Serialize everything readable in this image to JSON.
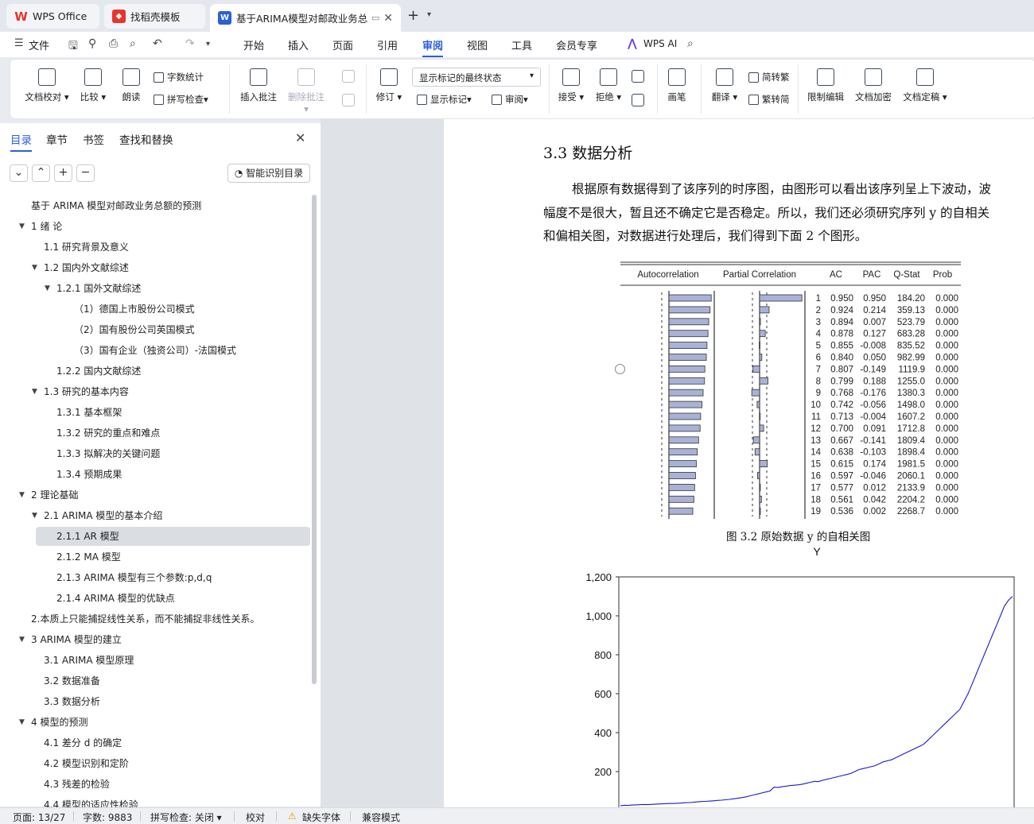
{
  "tabs": [
    {
      "label": "WPS Office",
      "icon": "wps-logo-icon",
      "color": "#e8342c"
    },
    {
      "label": "找稻壳模板",
      "icon": "docer-icon",
      "color": "#e8342c"
    },
    {
      "label": "基于ARIMA模型对邮政业务总",
      "icon": "word-doc-icon",
      "color": "#2b5fd9"
    }
  ],
  "menu": {
    "file": "文件",
    "items": [
      "开始",
      "插入",
      "页面",
      "引用",
      "审阅",
      "视图",
      "工具",
      "会员专享"
    ],
    "active": "审阅",
    "ai": "WPS AI"
  },
  "ribbon": {
    "doc_check": "文档校对",
    "compare": "比较",
    "read_aloud": "朗读",
    "word_count": "字数统计",
    "spell_check": "拼写检查",
    "insert_comment": "插入批注",
    "delete_comment": "删除批注",
    "revise": "修订",
    "mark_state": "显示标记的最终状态",
    "show_marks": "显示标记",
    "review": "审阅",
    "accept": "接受",
    "reject": "拒绝",
    "pen": "画笔",
    "translate": "翻译",
    "trad2simp": "简转繁",
    "simp2trad": "繁转简",
    "restrict": "限制编辑",
    "encrypt": "文档加密",
    "finalize": "文档定稿"
  },
  "sidebar": {
    "tabs": [
      "目录",
      "章节",
      "书签",
      "查找和替换"
    ],
    "smart_toc": "智能识别目录",
    "toc": [
      {
        "text": "基于 ARIMA 模型对邮政业务总额的预测",
        "level": 0
      },
      {
        "text": "1  绪  论",
        "level": 0,
        "arrow": true
      },
      {
        "text": "1.1  研究背景及意义",
        "level": 1
      },
      {
        "text": "1.2  国内外文献综述",
        "level": 1,
        "arrow": true
      },
      {
        "text": "1.2.1  国外文献综述",
        "level": 2,
        "arrow": true
      },
      {
        "text": "（1）德国上市股份公司模式",
        "level": 3
      },
      {
        "text": "（2）国有股份公司英国模式",
        "level": 3
      },
      {
        "text": "（3）国有企业（独资公司）-法国模式",
        "level": 3
      },
      {
        "text": "1.2.2  国内文献综述",
        "level": 2
      },
      {
        "text": "1.3  研究的基本内容",
        "level": 1,
        "arrow": true
      },
      {
        "text": "1.3.1  基本框架",
        "level": 2
      },
      {
        "text": "1.3.2  研究的重点和难点",
        "level": 2
      },
      {
        "text": "1.3.3  拟解决的关键问题",
        "level": 2
      },
      {
        "text": "1.3.4  预期成果",
        "level": 2
      },
      {
        "text": "2  理论基础",
        "level": 0,
        "arrow": true
      },
      {
        "text": "2.1    ARIMA 模型的基本介绍",
        "level": 1,
        "arrow": true
      },
      {
        "text": "2.1.1    AR 模型",
        "level": 2,
        "selected": true
      },
      {
        "text": "2.1.2    MA 模型",
        "level": 2
      },
      {
        "text": "2.1.3 ARIMA 模型有三个参数:p,d,q",
        "level": 2
      },
      {
        "text": "2.1.4    ARIMA 模型的优缺点",
        "level": 2
      },
      {
        "text": "2.本质上只能捕捉线性关系，而不能捕捉非线性关系。",
        "level": 0
      },
      {
        "text": "3 ARIMA 模型的建立",
        "level": 0,
        "arrow": true
      },
      {
        "text": "3.1 ARIMA 模型原理",
        "level": 1
      },
      {
        "text": "3.2  数据准备",
        "level": 1
      },
      {
        "text": "3.3  数据分析",
        "level": 1
      },
      {
        "text": "4  模型的预测",
        "level": 0,
        "arrow": true
      },
      {
        "text": "4.1  差分 d 的确定",
        "level": 1
      },
      {
        "text": "4.2  模型识别和定阶",
        "level": 1
      },
      {
        "text": "4.3 残差的检验",
        "level": 1
      },
      {
        "text": "4.4  模型的适应性检验",
        "level": 1
      }
    ]
  },
  "doc": {
    "heading": "3.3  数据分析",
    "para1": "根据原有数据得到了该序列的时序图，由图形可以看出该序列呈上下波动，波",
    "para2": "幅度不是很大，暂且还不确定它是否稳定。所以，我们还必须研究序列 y 的自相关",
    "para3": "和偏相关图，对数据进行处理后，我们得到下面 2 个图形。",
    "fig_caption": "图 3.2 原始数据 y 的自相关图"
  },
  "chart_data": [
    {
      "type": "table",
      "columns": [
        "Autocorrelation",
        "Partial Correlation",
        "",
        "AC",
        "PAC",
        "Q-Stat",
        "Prob"
      ],
      "lags": [
        1,
        2,
        3,
        4,
        5,
        6,
        7,
        8,
        9,
        10,
        11,
        12,
        13,
        14,
        15,
        16,
        17,
        18,
        19
      ],
      "ac": [
        0.95,
        0.924,
        0.894,
        0.878,
        0.855,
        0.84,
        0.807,
        0.799,
        0.768,
        0.742,
        0.713,
        0.7,
        0.667,
        0.638,
        0.615,
        0.597,
        0.577,
        0.561,
        0.536
      ],
      "pac": [
        0.95,
        0.214,
        0.007,
        0.127,
        -0.008,
        0.05,
        -0.149,
        0.188,
        -0.176,
        -0.056,
        -0.004,
        0.091,
        -0.141,
        -0.103,
        0.174,
        -0.046,
        0.012,
        0.042,
        0.002
      ],
      "qstat": [
        "184.20",
        "359.13",
        "523.79",
        "683.28",
        "835.52",
        "982.99",
        "1119.9",
        "1255.0",
        "1380.3",
        "1498.0",
        "1607.2",
        "1712.8",
        "1809.4",
        "1898.4",
        "1981.5",
        "2060.1",
        "2133.9",
        "2204.2",
        "2268.7"
      ],
      "prob": [
        "0.000",
        "0.000",
        "0.000",
        "0.000",
        "0.000",
        "0.000",
        "0.000",
        "0.000",
        "0.000",
        "0.000",
        "0.000",
        "0.000",
        "0.000",
        "0.000",
        "0.000",
        "0.000",
        "0.000",
        "0.000",
        "0.000"
      ],
      "ac_text": [
        "0.950",
        "0.924",
        "0.894",
        "0.878",
        "0.855",
        "0.840",
        "0.807",
        "0.799",
        "0.768",
        "0.742",
        "0.713",
        "0.700",
        "0.667",
        "0.638",
        "0.615",
        "0.597",
        "0.577",
        "0.561",
        "0.536"
      ],
      "pac_text": [
        "0.950",
        "0.214",
        "0.007",
        "0.127",
        "-0.008",
        "0.050",
        "-0.149",
        "0.188",
        "-0.176",
        "-0.056",
        "-0.004",
        "0.091",
        "-0.141",
        "-0.103",
        "0.174",
        "-0.046",
        "0.012",
        "0.042",
        "0.002"
      ]
    },
    {
      "type": "line",
      "title": "Y",
      "yticks": [
        "200",
        "400",
        "600",
        "800",
        "1,000",
        "1,200"
      ],
      "ytick_values": [
        200,
        400,
        600,
        800,
        1000,
        1200
      ],
      "ylim": [
        0,
        1200
      ],
      "line_color": "#1a1ad0",
      "y": [
        25,
        27,
        26,
        28,
        29,
        30,
        31,
        30,
        32,
        33,
        34,
        35,
        36,
        36,
        37,
        38,
        40,
        41,
        42,
        44,
        46,
        47,
        48,
        50,
        52,
        53,
        55,
        57,
        60,
        63,
        66,
        70,
        75,
        80,
        85,
        90,
        95,
        100,
        120,
        118,
        122,
        125,
        128,
        130,
        132,
        135,
        140,
        145,
        150,
        148,
        155,
        160,
        165,
        170,
        175,
        180,
        185,
        190,
        200,
        210,
        215,
        220,
        225,
        230,
        240,
        250,
        255,
        260,
        270,
        280,
        290,
        300,
        310,
        320,
        330,
        340,
        360,
        380,
        400,
        420,
        440,
        460,
        480,
        500,
        520,
        560,
        600,
        650,
        700,
        750,
        800,
        850,
        900,
        950,
        1000,
        1050,
        1080,
        1100
      ]
    }
  ],
  "status": {
    "page": "页面: 13/27",
    "words": "字数: 9883",
    "spell": "拼写检查: 关闭",
    "proof": "校对",
    "missing_font": "缺失字体",
    "compat": "兼容模式"
  }
}
